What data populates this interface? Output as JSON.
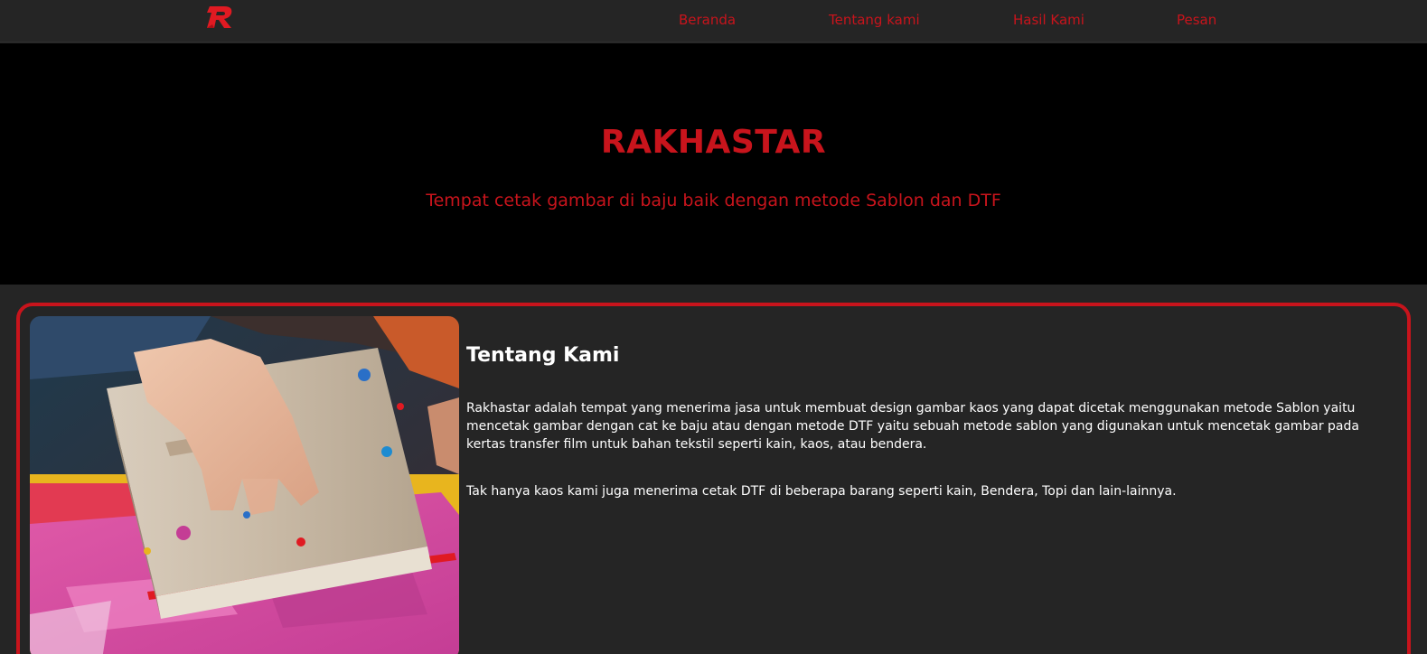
{
  "brand": {
    "logo_icon": "rakhastar-r-logo",
    "accent_color": "#c8141c"
  },
  "nav": {
    "items": [
      {
        "label": "Beranda"
      },
      {
        "label": "Tentang kami"
      },
      {
        "label": "Hasil Kami"
      },
      {
        "label": "Pesan"
      }
    ]
  },
  "hero": {
    "title": "RAKHASTAR",
    "subtitle": "Tempat cetak gambar di baju baik dengan metode Sablon dan DTF"
  },
  "about": {
    "heading": "Tentang Kami",
    "paragraphs": [
      "Rakhastar adalah tempat yang menerima jasa untuk membuat design gambar kaos yang dapat dicetak menggunakan metode Sablon yaitu mencetak gambar dengan cat ke baju atau dengan metode DTF yaitu sebuah metode sablon yang digunakan untuk mencetak gambar pada kertas transfer film untuk bahan tekstil seperti kain, kaos, atau bendera.",
      "Tak hanya kaos kami juga menerima cetak DTF di beberapa barang seperti kain, Bendera, Topi dan lain-lainnya."
    ],
    "image_subject": "screen-printing-squeegee-photo"
  }
}
